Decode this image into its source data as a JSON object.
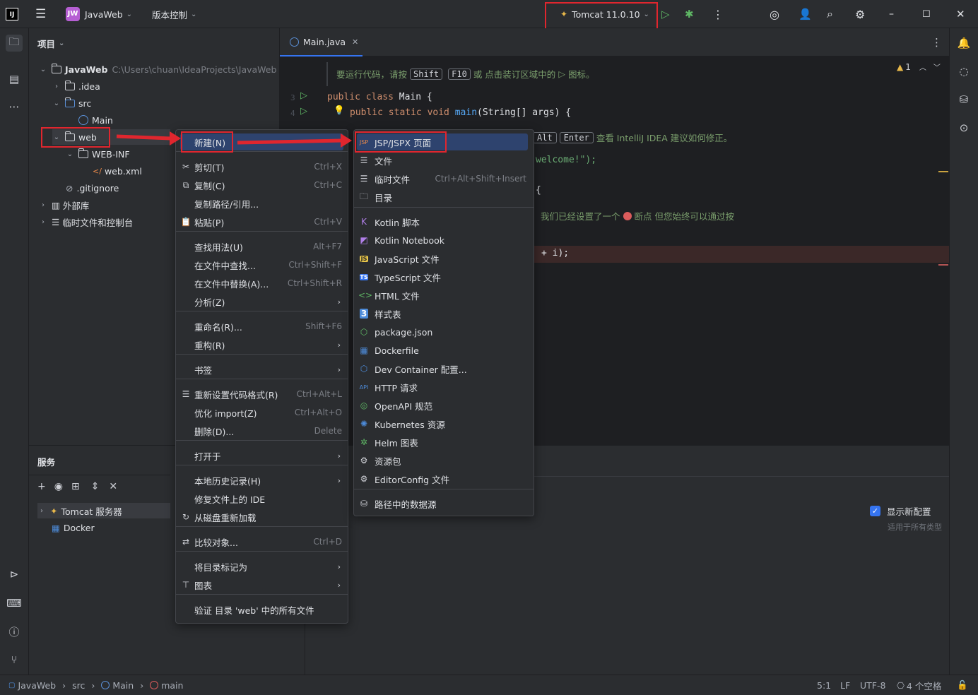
{
  "titlebar": {
    "logo": "IJ",
    "menu_icon": "hamburger-icon",
    "project_badge": "JW",
    "project_name": "JavaWeb",
    "vcs_label": "版本控制",
    "run_config": "Tomcat 11.0.10"
  },
  "project_panel": {
    "title": "项目",
    "tree": [
      {
        "label": "JavaWeb",
        "path": "C:\\Users\\chuan\\IdeaProjects\\JavaWeb"
      },
      {
        "label": ".idea"
      },
      {
        "label": "src"
      },
      {
        "label": "Main"
      },
      {
        "label": "web"
      },
      {
        "label": "WEB-INF"
      },
      {
        "label": "web.xml"
      },
      {
        "label": ".gitignore"
      },
      {
        "label": "外部库"
      },
      {
        "label": "临时文件和控制台"
      }
    ]
  },
  "services_panel": {
    "title": "服务",
    "items": [
      {
        "label": "Tomcat 服务器"
      },
      {
        "label": "Docker"
      }
    ],
    "show_new_config": "显示新配置",
    "applies_to_all": "适用于所有类型"
  },
  "editor": {
    "tab": "Main.java",
    "hint": "要运行代码，请按",
    "hint_key1": "Shift",
    "hint_key2": "F10",
    "hint_rest": "或 点击装订区域中的",
    "hint_tail": "图标。",
    "warning_count": "1",
    "line_nums": [
      "3",
      "4"
    ],
    "code_line1_kw": "public class",
    "code_line1_rest": " Main {",
    "code_line2_kw": "public static void",
    "code_line2_fn": "main",
    "code_line2_rest": "(String[] args) {",
    "hint2_key1": "Alt",
    "hint2_key2": "Enter",
    "hint2_rest": "查看 IntelliJ IDEA 建议如何修正。",
    "code_welcome": "welcome!\");",
    "code_brace": "{",
    "hint3": "我们已经设置了一个",
    "hint3_rest": "断点 但您始终可以通过按",
    "code_i": "+ i);"
  },
  "context_menu": {
    "items": [
      {
        "label": "新建(N)",
        "shortcut": ""
      },
      {
        "label": "剪切(T)",
        "shortcut": "Ctrl+X"
      },
      {
        "label": "复制(C)",
        "shortcut": "Ctrl+C"
      },
      {
        "label": "复制路径/引用...",
        "shortcut": ""
      },
      {
        "label": "粘贴(P)",
        "shortcut": "Ctrl+V"
      },
      {
        "label": "查找用法(U)",
        "shortcut": "Alt+F7"
      },
      {
        "label": "在文件中查找...",
        "shortcut": "Ctrl+Shift+F"
      },
      {
        "label": "在文件中替换(A)...",
        "shortcut": "Ctrl+Shift+R"
      },
      {
        "label": "分析(Z)",
        "shortcut": ""
      },
      {
        "label": "重命名(R)...",
        "shortcut": "Shift+F6"
      },
      {
        "label": "重构(R)",
        "shortcut": ""
      },
      {
        "label": "书签",
        "shortcut": ""
      },
      {
        "label": "重新设置代码格式(R)",
        "shortcut": "Ctrl+Alt+L"
      },
      {
        "label": "优化 import(Z)",
        "shortcut": "Ctrl+Alt+O"
      },
      {
        "label": "删除(D)...",
        "shortcut": "Delete"
      },
      {
        "label": "打开于",
        "shortcut": ""
      },
      {
        "label": "本地历史记录(H)",
        "shortcut": ""
      },
      {
        "label": "修复文件上的 IDE",
        "shortcut": ""
      },
      {
        "label": "从磁盘重新加载",
        "shortcut": ""
      },
      {
        "label": "比较对象...",
        "shortcut": "Ctrl+D"
      },
      {
        "label": "将目录标记为",
        "shortcut": ""
      },
      {
        "label": "图表",
        "shortcut": ""
      },
      {
        "label": "验证 目录 'web' 中的所有文件",
        "shortcut": ""
      }
    ]
  },
  "new_submenu": {
    "items": [
      {
        "label": "JSP/JSPX 页面",
        "shortcut": ""
      },
      {
        "label": "文件",
        "shortcut": ""
      },
      {
        "label": "临时文件",
        "shortcut": "Ctrl+Alt+Shift+Insert"
      },
      {
        "label": "目录",
        "shortcut": ""
      },
      {
        "label": "Kotlin 脚本",
        "shortcut": ""
      },
      {
        "label": "Kotlin Notebook",
        "shortcut": ""
      },
      {
        "label": "JavaScript 文件",
        "shortcut": ""
      },
      {
        "label": "TypeScript 文件",
        "shortcut": ""
      },
      {
        "label": "HTML 文件",
        "shortcut": ""
      },
      {
        "label": "样式表",
        "shortcut": ""
      },
      {
        "label": "package.json",
        "shortcut": ""
      },
      {
        "label": "Dockerfile",
        "shortcut": ""
      },
      {
        "label": "Dev Container 配置...",
        "shortcut": ""
      },
      {
        "label": "HTTP 请求",
        "shortcut": ""
      },
      {
        "label": "OpenAPI 规范",
        "shortcut": ""
      },
      {
        "label": "Kubernetes 资源",
        "shortcut": ""
      },
      {
        "label": "Helm 图表",
        "shortcut": ""
      },
      {
        "label": "资源包",
        "shortcut": ""
      },
      {
        "label": "EditorConfig 文件",
        "shortcut": ""
      },
      {
        "label": "路径中的数据源",
        "shortcut": ""
      }
    ],
    "icon_labels": {
      "jsp": "JSP",
      "js": "JS",
      "ts": "TS",
      "api": "API"
    }
  },
  "statusbar": {
    "crumbs": [
      "JavaWeb",
      "src",
      "Main",
      "main"
    ],
    "position": "5:1",
    "line_sep": "LF",
    "encoding": "UTF-8",
    "indent": "4 个空格"
  },
  "colors": {
    "accent": "#3574f0",
    "highlight": "#e0262e",
    "selection": "#2e436e"
  }
}
